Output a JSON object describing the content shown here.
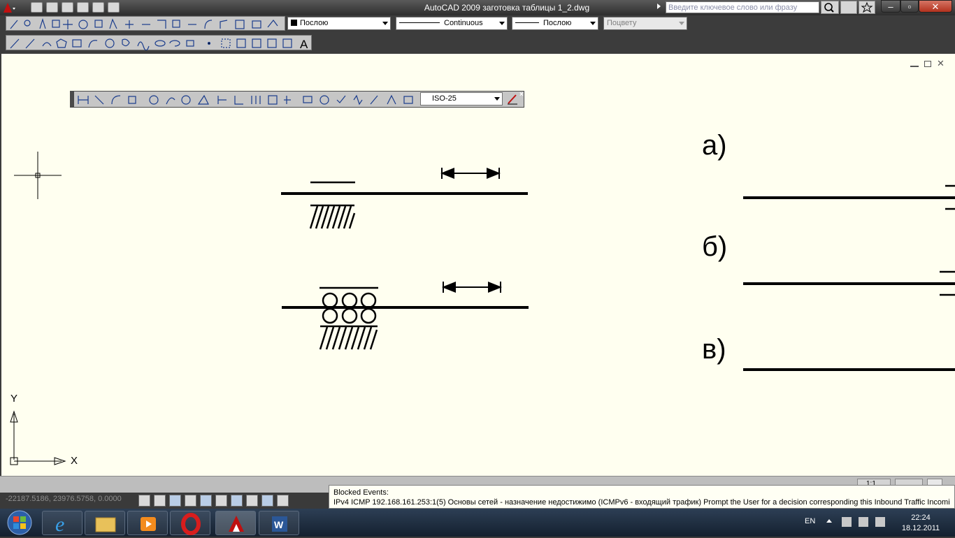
{
  "window": {
    "title": "AutoCAD 2009 заготовка таблицы 1_2.dwg",
    "search_placeholder": "Введите ключевое слово или фразу"
  },
  "properties": {
    "color": "Послою",
    "linetype": "Continuous",
    "lineweight": "Послою",
    "plotstyle": "Поцвету"
  },
  "dim_toolbar": {
    "style": "ISO-25"
  },
  "drawing": {
    "labels": [
      "а)",
      "б)",
      "в)"
    ]
  },
  "ucs": {
    "x": "X",
    "y": "Y"
  },
  "status": {
    "coords": "-22187.5186, 23976.5758, 0.0000",
    "scale": "1:1"
  },
  "tooltip": {
    "title": "Blocked Events:",
    "text": "IPv4 ICMP 192.168.161.253:1(5) Основы сетей - назначение недостижимо (ICMPv6 - входящий трафик) Prompt the User for a decision corresponding this Inbound Traffic Incoming"
  },
  "tray": {
    "lang": "EN",
    "time": "22:24",
    "date": "18.12.2011"
  }
}
